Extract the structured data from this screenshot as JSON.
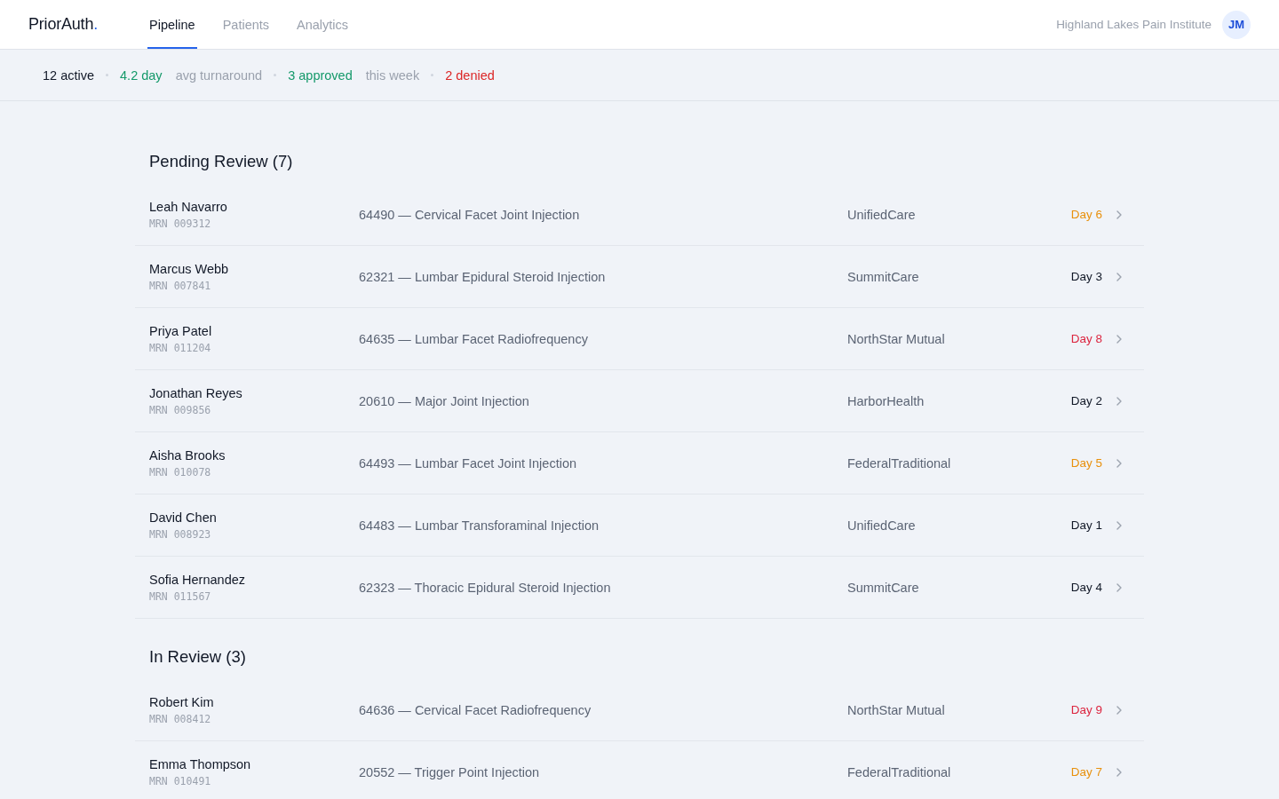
{
  "header": {
    "logo": {
      "name": "PriorAuth",
      "dot": "."
    },
    "tabs": [
      {
        "label": "Pipeline",
        "selected": true
      },
      {
        "label": "Patients",
        "selected": false
      },
      {
        "label": "Analytics",
        "selected": false
      }
    ],
    "organization": "Highland Lakes Pain Institute",
    "user": {
      "initials": "JM"
    }
  },
  "stats": [
    {
      "value": "12 active",
      "color": "#111827"
    },
    {
      "value": "4.2 day",
      "color": "#14996a",
      "label": "avg turnaround"
    },
    {
      "value": "3 approved",
      "color": "#14996a",
      "label": "this week"
    },
    {
      "value": "2 denied",
      "color": "#dc2626"
    }
  ],
  "sections": [
    {
      "title": "Pending Review (7)",
      "rows": [
        {
          "patient": "Leah Navarro",
          "mrn": "MRN 009312",
          "procedure": "64490 — Cervical Facet Joint Injection",
          "payer": "UnifiedCare",
          "day": "Day 6",
          "color": "#e8900c"
        },
        {
          "patient": "Marcus Webb",
          "mrn": "MRN 007841",
          "procedure": "62321 — Lumbar Epidural Steroid Injection",
          "payer": "SummitCare",
          "day": "Day 3",
          "color": "#111827"
        },
        {
          "patient": "Priya Patel",
          "mrn": "MRN 011204",
          "procedure": "64635 — Lumbar Facet Radiofrequency",
          "payer": "NorthStar Mutual",
          "day": "Day 8",
          "color": "#dc2640"
        },
        {
          "patient": "Jonathan Reyes",
          "mrn": "MRN 009856",
          "procedure": "20610 — Major Joint Injection",
          "payer": "HarborHealth",
          "day": "Day 2",
          "color": "#111827"
        },
        {
          "patient": "Aisha Brooks",
          "mrn": "MRN 010078",
          "procedure": "64493 — Lumbar Facet Joint Injection",
          "payer": "FederalTraditional",
          "day": "Day 5",
          "color": "#e8900c"
        },
        {
          "patient": "David Chen",
          "mrn": "MRN 008923",
          "procedure": "64483 — Lumbar Transforaminal Injection",
          "payer": "UnifiedCare",
          "day": "Day 1",
          "color": "#111827"
        },
        {
          "patient": "Sofia Hernandez",
          "mrn": "MRN 011567",
          "procedure": "62323 — Thoracic Epidural Steroid Injection",
          "payer": "SummitCare",
          "day": "Day 4",
          "color": "#111827"
        }
      ]
    },
    {
      "title": "In Review (3)",
      "rows": [
        {
          "patient": "Robert Kim",
          "mrn": "MRN 008412",
          "procedure": "64636 — Cervical Facet Radiofrequency",
          "payer": "NorthStar Mutual",
          "day": "Day 9",
          "color": "#dc2640"
        },
        {
          "patient": "Emma Thompson",
          "mrn": "MRN 010491",
          "procedure": "20552 — Trigger Point Injection",
          "payer": "FederalTraditional",
          "day": "Day 7",
          "color": "#e8900c"
        }
      ]
    }
  ]
}
